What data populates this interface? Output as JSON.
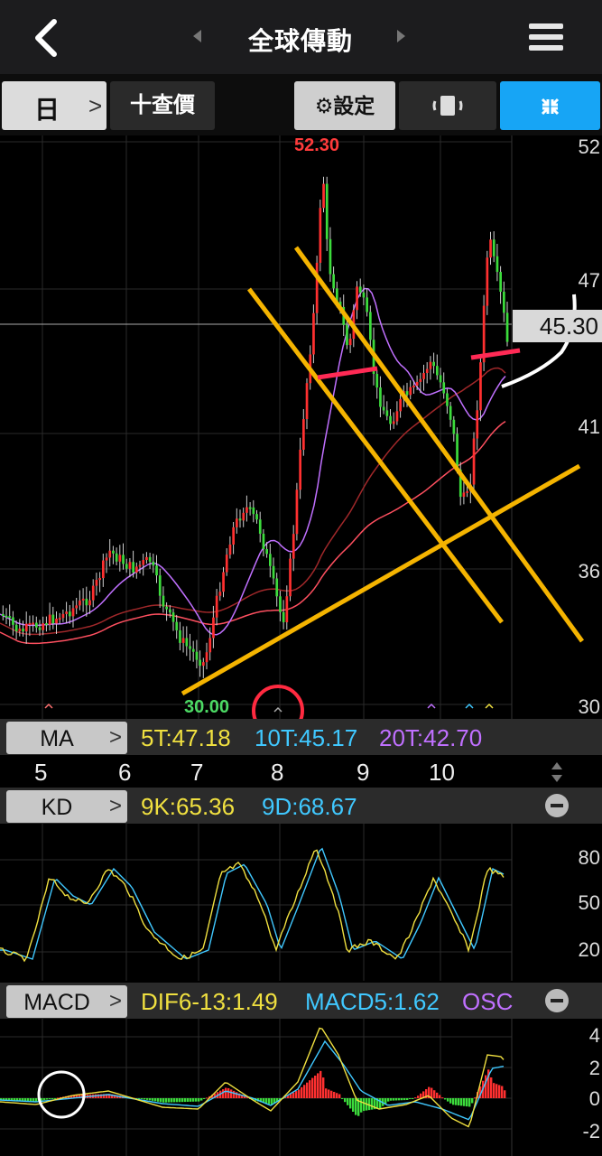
{
  "header": {
    "title": "全球傳動"
  },
  "toolbar": {
    "period": "日",
    "quote": "十查價",
    "settings": "⚙設定"
  },
  "price": {
    "y_ticks": [
      "52",
      "47",
      "41",
      "36",
      "30"
    ],
    "current": "45.30",
    "high_marker": "52.30",
    "low_marker": "30.00"
  },
  "ma": {
    "button": "MA",
    "t5": "5T:47.18",
    "t10": "10T:45.17",
    "t20": "20T:42.70"
  },
  "months": [
    "5",
    "6",
    "7",
    "8",
    "9",
    "10"
  ],
  "kd": {
    "button": "KD",
    "k": "9K:65.36",
    "d": "9D:68.67",
    "y_ticks": [
      "80",
      "50",
      "20"
    ]
  },
  "macd": {
    "button": "MACD",
    "dif": "DIF6-13:1.49",
    "macd": "MACD5:1.62",
    "osc": "OSC",
    "y_ticks": [
      "4",
      "2",
      "0",
      "-2"
    ]
  },
  "colors": {
    "up": "#ff3030",
    "down": "#3cdc3c",
    "accent": "#17a5f5",
    "trendline": "#f5b400"
  }
}
